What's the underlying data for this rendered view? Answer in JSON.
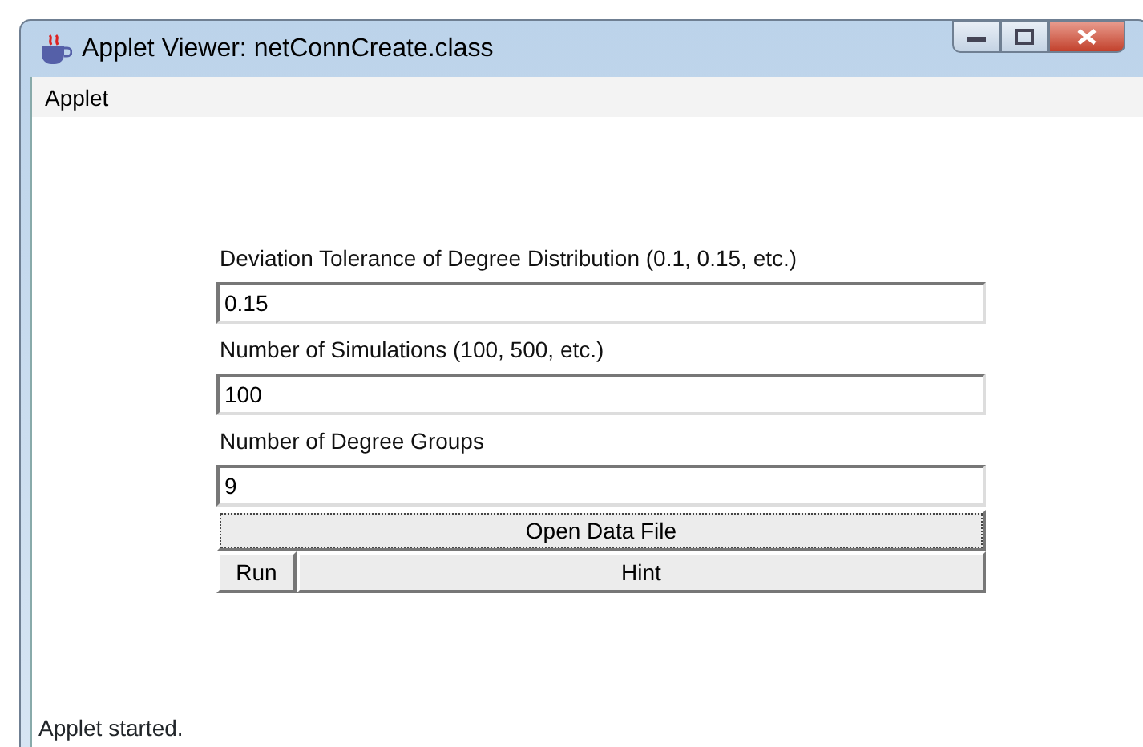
{
  "window": {
    "title": "Applet Viewer: netConnCreate.class"
  },
  "menu": [
    "Applet"
  ],
  "fields": [
    {
      "label": "Deviation Tolerance of Degree Distribution (0.1, 0.15, etc.)",
      "value": "0.15"
    },
    {
      "label": "Number of Simulations (100, 500, etc.)",
      "value": "100"
    },
    {
      "label": "Number of Degree Groups",
      "value": "9"
    }
  ],
  "buttons": {
    "open": "Open Data File",
    "run": "Run",
    "hint": "Hint"
  },
  "status_bar": "Applet started."
}
